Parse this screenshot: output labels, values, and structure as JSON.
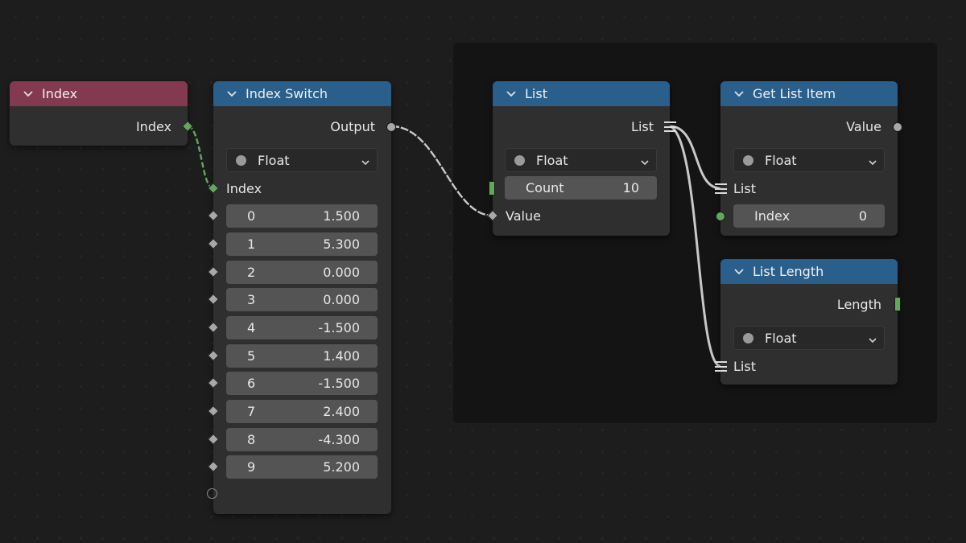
{
  "nodes": {
    "index": {
      "title": "Index",
      "output": "Index"
    },
    "index_switch": {
      "title": "Index Switch",
      "output": "Output",
      "type": "Float",
      "index_label": "Index",
      "items": [
        {
          "key": "0",
          "value": "1.500"
        },
        {
          "key": "1",
          "value": "5.300"
        },
        {
          "key": "2",
          "value": "0.000"
        },
        {
          "key": "3",
          "value": "0.000"
        },
        {
          "key": "4",
          "value": "-1.500"
        },
        {
          "key": "5",
          "value": "1.400"
        },
        {
          "key": "6",
          "value": "-1.500"
        },
        {
          "key": "7",
          "value": "2.400"
        },
        {
          "key": "8",
          "value": "-4.300"
        },
        {
          "key": "9",
          "value": "5.200"
        }
      ]
    },
    "list": {
      "title": "List",
      "output": "List",
      "type": "Float",
      "count_label": "Count",
      "count_value": "10",
      "value_label": "Value"
    },
    "get_list_item": {
      "title": "Get List Item",
      "output": "Value",
      "type": "Float",
      "list_label": "List",
      "index_label": "Index",
      "index_value": "0"
    },
    "list_length": {
      "title": "List Length",
      "output": "Length",
      "type": "Float",
      "list_label": "List"
    }
  },
  "colors": {
    "header_blue": "#2a5f8c",
    "header_red": "#833a50",
    "socket_green": "#62a85c",
    "socket_gray": "#a8a8a8",
    "wire": "#c8c8c8"
  },
  "icons": [
    "chevron-down-icon",
    "dropdown-arrow-icon",
    "diamond-socket-icon",
    "circle-socket-icon",
    "list-socket-icon",
    "field-socket-icon"
  ]
}
